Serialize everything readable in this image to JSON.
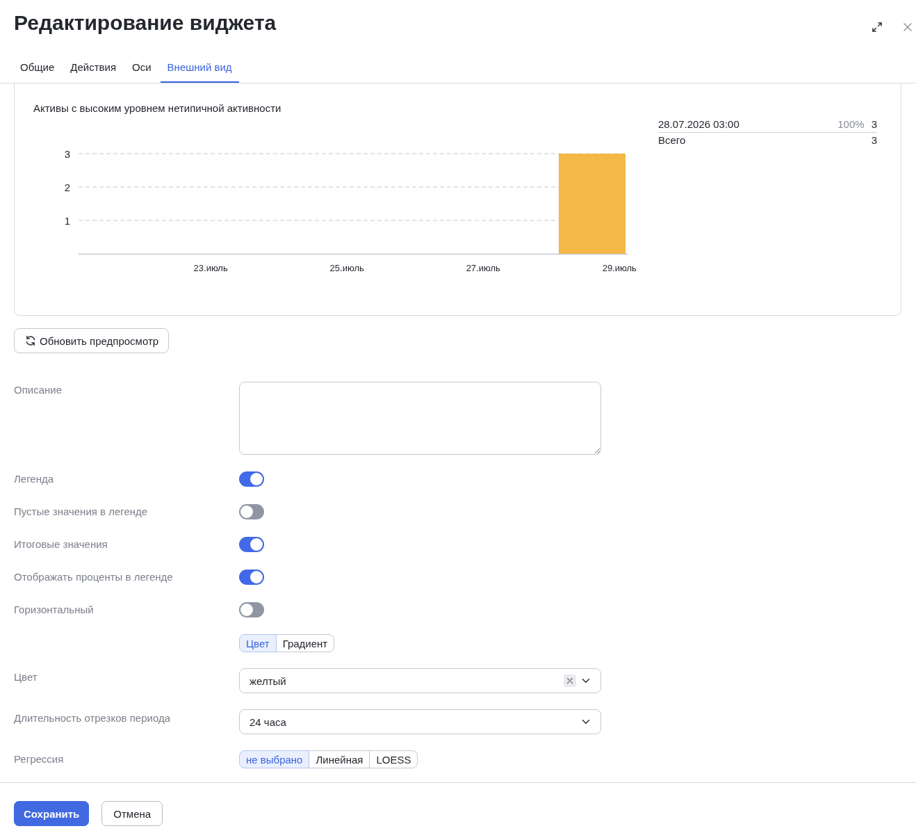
{
  "window": {
    "title": "Редактирование виджета"
  },
  "tabs": [
    {
      "label": "Общие",
      "selected": false
    },
    {
      "label": "Действия",
      "selected": false
    },
    {
      "label": "Оси",
      "selected": false
    },
    {
      "label": "Внешний вид",
      "selected": true
    }
  ],
  "preview": {
    "chart_data": {
      "type": "bar",
      "title": "Активы с высоким уровнем нетипичной активности",
      "x": [
        28.61
      ],
      "series": [
        {
          "color": "#f3b845",
          "values": [
            3
          ]
        }
      ],
      "xlim": [
        21.06,
        29.12
      ],
      "ylim": [
        0,
        3
      ],
      "xticks": [
        {
          "value": 23,
          "label": "23.июль"
        },
        {
          "value": 25,
          "label": "25.июль"
        },
        {
          "value": 27,
          "label": "27.июль"
        },
        {
          "value": 29,
          "label": "29.июль"
        }
      ],
      "yticks": [
        1,
        2,
        3
      ]
    },
    "legend": {
      "rows": [
        {
          "label": "28.07.2026 03:00",
          "percent": "100%",
          "value": "3"
        }
      ],
      "total": {
        "label": "Всего",
        "value": "3"
      }
    }
  },
  "refresh_button": {
    "label": "Обновить предпросмотр"
  },
  "form": {
    "fields": [
      {
        "kind": "textarea",
        "label": "Описание"
      },
      {
        "kind": "toggle",
        "label": "Легенда",
        "on": true
      },
      {
        "kind": "toggle",
        "label": "Пустые значения в легенде",
        "on": false
      },
      {
        "kind": "toggle",
        "label": "Итоговые значения",
        "on": true
      },
      {
        "kind": "toggle",
        "label": "Отображать проценты в легенде",
        "on": true
      },
      {
        "kind": "toggle",
        "label": "Горизонтальный",
        "on": false
      },
      {
        "kind": "segmented",
        "options": [
          {
            "label": "Цвет",
            "selected": true
          },
          {
            "label": "Градиент",
            "selected": false
          }
        ]
      },
      {
        "kind": "select",
        "label": "Цвет",
        "value": "желтый",
        "clearable": true
      },
      {
        "kind": "select",
        "label": "Длительность отрезков периода",
        "value": "24 часа",
        "clearable": false
      },
      {
        "kind": "segmented",
        "label": "Регрессия",
        "options": [
          {
            "label": "не выбрано",
            "selected": true
          },
          {
            "label": "Линейная",
            "selected": false
          },
          {
            "label": "LOESS",
            "selected": false
          }
        ]
      }
    ]
  },
  "footer": {
    "buttons": [
      {
        "kind": "primary",
        "label": "Сохранить"
      },
      {
        "kind": "secondary",
        "label": "Отмена"
      }
    ]
  }
}
